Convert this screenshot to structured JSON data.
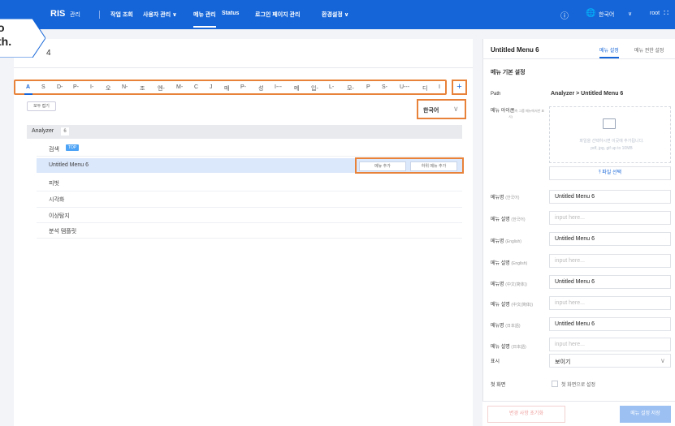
{
  "topnav": {
    "brand": "RIS",
    "brand_sub": "관리",
    "items": [
      "작업 조회",
      "사용자 관리 ∨",
      "메뉴 관리",
      "Status",
      "로그인 페이지 관리",
      "환경설정 ∨"
    ],
    "help_icon": "help-circle-icon",
    "lang": "한국어",
    "user": "root",
    "grid_icon": "apps-grid-icon"
  },
  "callout": {
    "line1": "o",
    "line2": "th."
  },
  "left": {
    "title_fragment": "4",
    "alpha_tabs": [
      "A",
      "S",
      "D-",
      "P-",
      "I-",
      "오",
      "N-",
      "조",
      "엔-",
      "M-",
      "C",
      "J",
      "매",
      "P-",
      "성",
      "I---",
      "메",
      "입-",
      "L-",
      "모-",
      "P",
      "S-",
      "U---",
      "디",
      "I"
    ],
    "add_label": "+",
    "expand_all": "모두 접기",
    "language": "한국어",
    "tree_root": {
      "label": "Analyzer",
      "count": "6"
    },
    "items": [
      {
        "label": "검색",
        "badge": "TOP"
      },
      {
        "label": "Untitled Menu 6"
      },
      {
        "label": "피벗"
      },
      {
        "label": "시각화"
      },
      {
        "label": "이상탐지"
      },
      {
        "label": "분석 템플릿"
      }
    ],
    "actions": {
      "add_menu": "메뉴 추가",
      "add_sub_menu": "하위 메뉴 추가"
    }
  },
  "right": {
    "title": "Untitled Menu 6",
    "tabs": [
      "메뉴 설정",
      "메뉴 권한 설정"
    ],
    "section": "메뉴 기본 설정",
    "path_label": "Path",
    "path_value": "Analyzer > Untitled Menu 6",
    "icon_label": "메뉴 아이콘",
    "icon_sub": "(* 최측 그룹 메뉴에서만 표시)",
    "upload_text1": "파일을 선택하시면 이곳에 추가됩니다.",
    "upload_text2": "pdf, jpg, gif up to 10MB",
    "file_button": "⤒ 파일 선택",
    "fields": [
      {
        "label": "메뉴명",
        "sub": "(한국어)",
        "value": "Untitled Menu 6",
        "placeholder": false
      },
      {
        "label": "메뉴 설명",
        "sub": "(한국어)",
        "value": "input here...",
        "placeholder": true
      },
      {
        "label": "메뉴명",
        "sub": "(English)",
        "value": "Untitled Menu 6",
        "placeholder": false
      },
      {
        "label": "메뉴 설명",
        "sub": "(English)",
        "value": "input here...",
        "placeholder": true
      },
      {
        "label": "메뉴명",
        "sub": "(中文(简体))",
        "value": "Untitled Menu 6",
        "placeholder": false
      },
      {
        "label": "메뉴 설명",
        "sub": "(中文(简体))",
        "value": "input here...",
        "placeholder": true
      },
      {
        "label": "메뉴명",
        "sub": "(日本語)",
        "value": "Untitled Menu 6",
        "placeholder": false
      },
      {
        "label": "메뉴 설명",
        "sub": "(日本語)",
        "value": "input here...",
        "placeholder": true
      }
    ],
    "display_label": "표시",
    "display_value": "보이기",
    "first_screen_label": "첫 화면",
    "first_screen_check": "첫 화면으로 설정",
    "reset_button": "변경 사항 초기화",
    "save_button": "메뉴 설정 저장"
  },
  "colors": {
    "primary": "#1565d8",
    "highlight": "#e8823a",
    "selected_row": "#dbe7fb"
  }
}
